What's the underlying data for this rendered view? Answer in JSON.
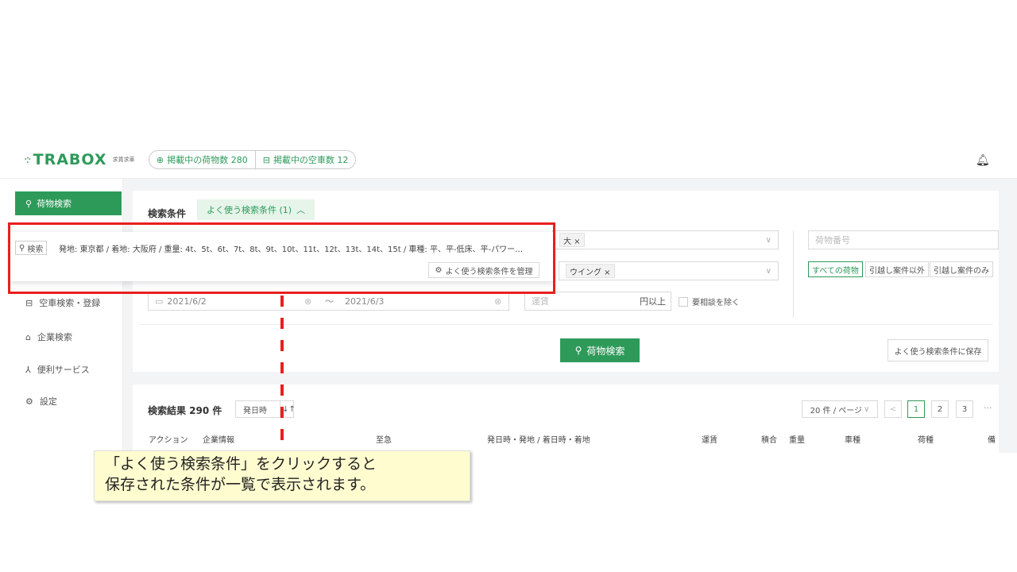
{
  "header": {
    "logo_text": "TRABOX",
    "logo_sub": "求貨求車",
    "cargo_count_label": "掲載中の荷物数 280",
    "truck_count_label": "掲載中の空車数 12"
  },
  "sidebar": {
    "items": [
      {
        "label": "荷物検索",
        "icon": "search-icon",
        "active": true
      },
      {
        "label": "空車検索・登録",
        "icon": "truck-icon"
      },
      {
        "label": "企業検索",
        "icon": "home-icon"
      },
      {
        "label": "便利サービス",
        "icon": "network-icon"
      },
      {
        "label": "設定",
        "icon": "gear-icon"
      }
    ]
  },
  "search": {
    "title": "検索条件",
    "saved_tab": "よく使う検索条件 (1)",
    "size_tag": "大 ×",
    "body_tag": "ウイング ×",
    "partial_x1": "×",
    "partial_x2": "×",
    "date_from": "2021/6/2",
    "date_to": "2021/6/3",
    "tilde": "～",
    "fare_placeholder": "運賃",
    "fare_suffix": "円以上",
    "exclude_negotiable": "要相談を除く",
    "cargo_no_placeholder": "荷物番号",
    "filter_options": [
      "すべての荷物",
      "引越し案件以外",
      "引越し案件のみ"
    ],
    "search_button": "荷物検索",
    "save_button": "よく使う検索条件に保存"
  },
  "dropdown": {
    "chip_label": "検索",
    "condition_text": "発地: 東京都 / 着地: 大阪府 / 重量: 4t、5t、6t、7t、8t、9t、10t、11t、12t、13t、14t、15t / 車種: 平、平-低床、平-パワー…",
    "manage_button": "よく使う検索条件を管理"
  },
  "results": {
    "title": "検索結果 290 件",
    "sort_label": "発日時",
    "per_page": "20 件 / ページ",
    "pages": [
      "1",
      "2",
      "3"
    ],
    "prev": "<",
    "more": "···",
    "columns": [
      "アクション",
      "企業情報",
      "至急",
      "発日時・発地 / 着日時・着地",
      "運賃",
      "積合",
      "重量",
      "車種",
      "荷種",
      "備"
    ]
  },
  "callout": {
    "line1": "「よく使う検索条件」をクリックすると",
    "line2": "保存された条件が一覧で表示されます。"
  },
  "colors": {
    "brand": "#2e9a5a",
    "highlight": "#e8201e",
    "callout_bg": "#fffdd0"
  }
}
